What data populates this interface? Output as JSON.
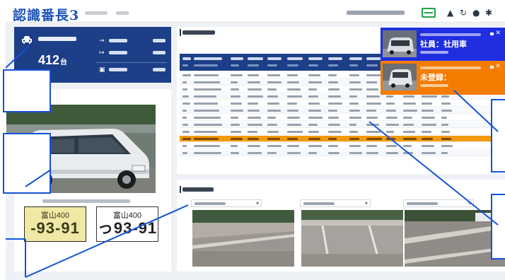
{
  "header": {
    "logo": "認識番長3",
    "icons": [
      "switch-icon",
      "bell-icon",
      "refresh-icon",
      "user-icon",
      "gear-icon"
    ]
  },
  "colors": {
    "brand_blue": "#1d3f87",
    "notification_blue": "#1f2fe0",
    "notification_orange": "#f47c00",
    "selected_row": "#f19a0c",
    "callout_blue": "#1553d8"
  },
  "count_panel": {
    "value": "412",
    "unit": "台"
  },
  "vehicle_panel": {
    "plate_detected": {
      "region": "富山400",
      "number": "-93-91"
    },
    "plate_registered": {
      "region": "富山400",
      "number": "っ93-91"
    }
  },
  "notifications": [
    {
      "title": "社員：社用車",
      "color": "#1f2fe0"
    },
    {
      "title": "未登録：",
      "color": "#f47c00"
    }
  ],
  "list_panel": {
    "selected_row_index": 9,
    "row_count": 12
  },
  "live_view": {
    "camera_count": 3
  }
}
